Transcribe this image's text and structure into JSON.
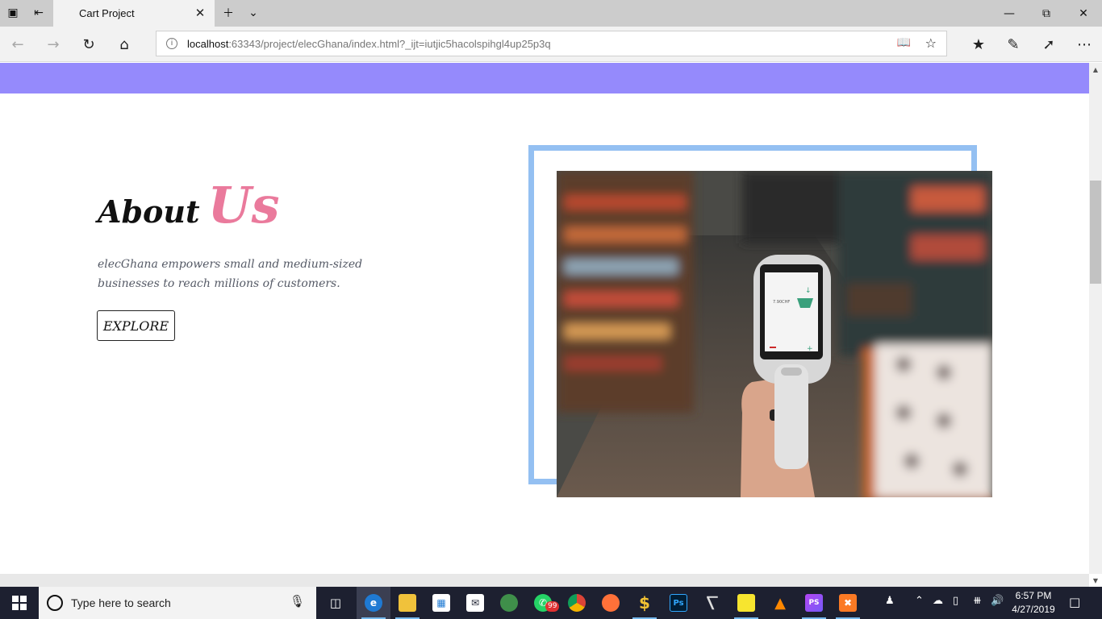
{
  "browser": {
    "tab_title": "Cart Project",
    "url_host": "localhost",
    "url_rest": ":63343/project/elecGhana/index.html?_ijt=iutjic5hacolspihgl4up25p3q"
  },
  "page": {
    "about_word": "About",
    "about_accent": "Us",
    "description": "elecGhana empowers small and medium-sized businesses to reach millions of customers.",
    "explore_label": "EXPLORE",
    "colors": {
      "top_bar": "#958afc",
      "accent": "#ea7a9c",
      "frame": "#94c0f2"
    }
  },
  "taskbar": {
    "search_placeholder": "Type here to search",
    "whatsapp_badge": "99",
    "time": "6:57 PM",
    "date": "4/27/2019",
    "icons": [
      "task-view-icon",
      "edge-icon",
      "file-explorer-icon",
      "store-icon",
      "mail-icon",
      "globe-icon",
      "whatsapp-icon",
      "chrome-icon",
      "firefox-icon",
      "dollar-app-icon",
      "photoshop-icon",
      "usb-tool-icon",
      "sticky-notes-icon",
      "vlc-icon",
      "phpstorm-icon",
      "xampp-icon"
    ]
  }
}
